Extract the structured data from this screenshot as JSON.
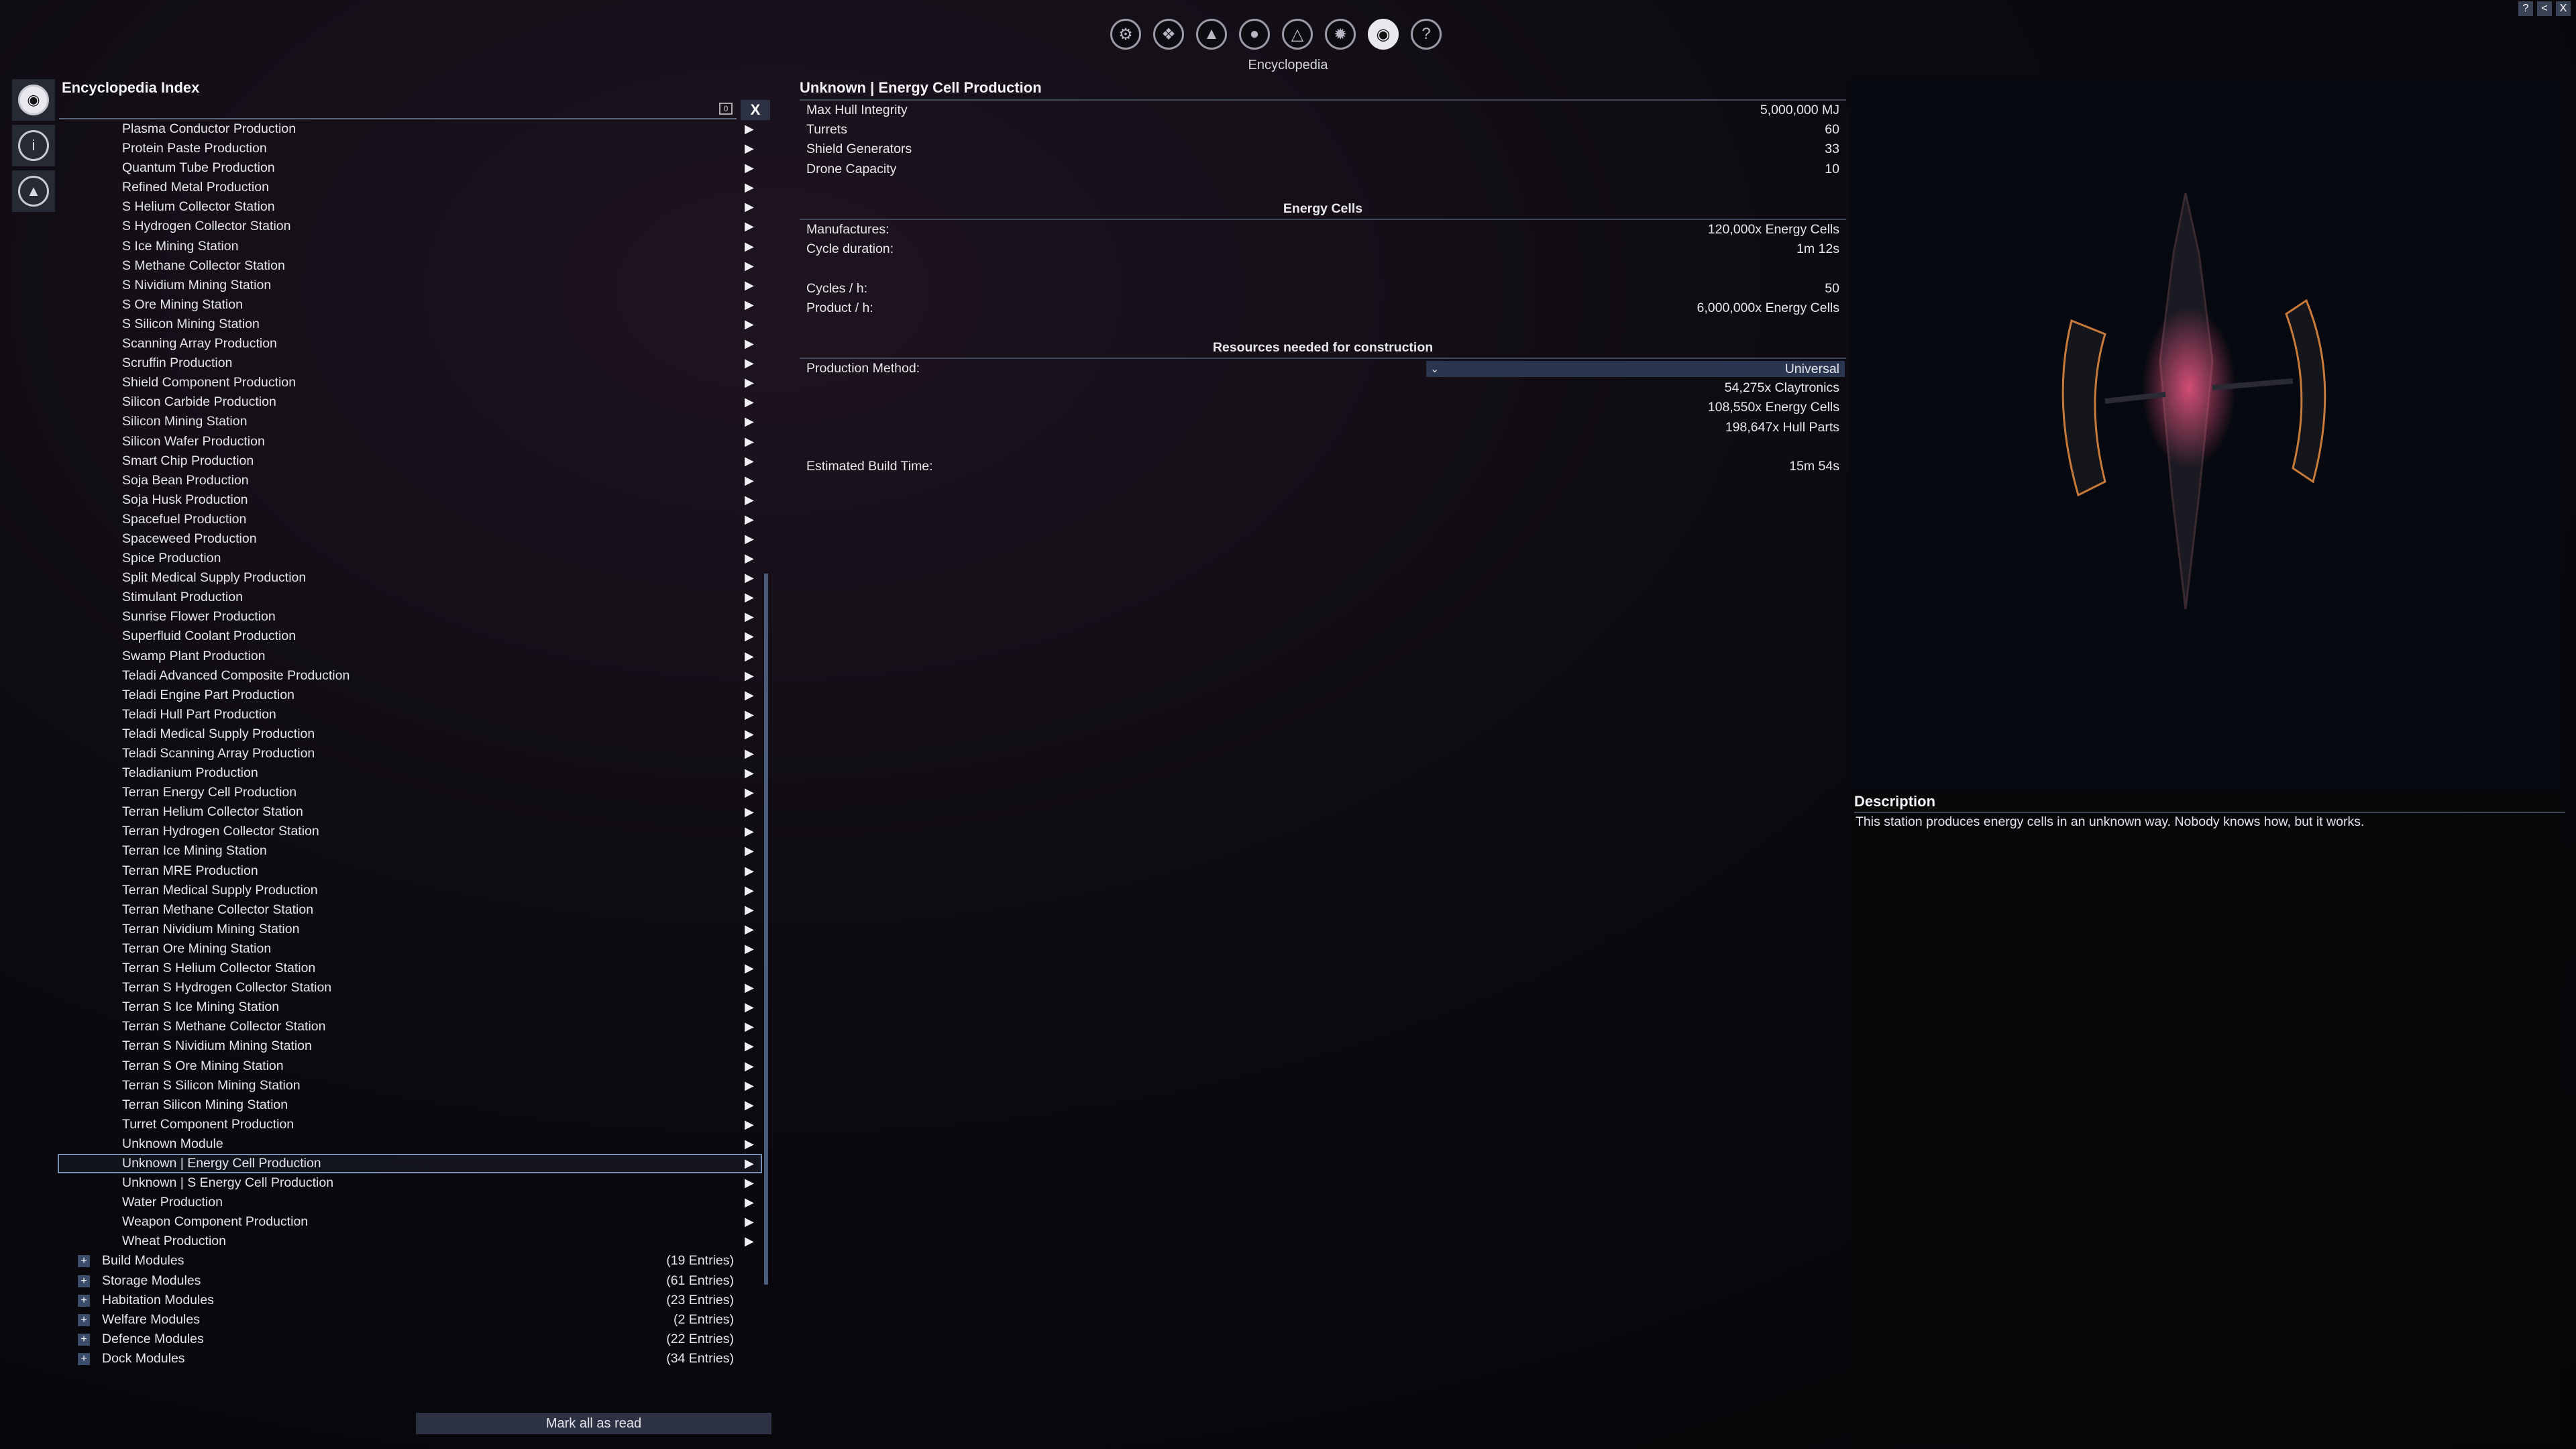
{
  "top_nav": {
    "title": "Encyclopedia",
    "icons": [
      "gear-icon",
      "satellite-icon",
      "ship-icon",
      "person-icon",
      "rocket-icon",
      "wreckage-icon",
      "station-icon",
      "help-icon"
    ]
  },
  "window_buttons": [
    "?",
    "<",
    "X"
  ],
  "index": {
    "title": "Encyclopedia Index",
    "search_clear": "0",
    "search_x": "X",
    "items": [
      "Plasma Conductor Production",
      "Protein Paste Production",
      "Quantum Tube Production",
      "Refined Metal Production",
      "S Helium Collector Station",
      "S Hydrogen Collector Station",
      "S Ice Mining Station",
      "S Methane Collector Station",
      "S Nividium Mining Station",
      "S Ore Mining Station",
      "S Silicon Mining Station",
      "Scanning Array Production",
      "Scruffin Production",
      "Shield Component Production",
      "Silicon Carbide Production",
      "Silicon Mining Station",
      "Silicon Wafer Production",
      "Smart Chip Production",
      "Soja Bean Production",
      "Soja Husk Production",
      "Spacefuel Production",
      "Spaceweed Production",
      "Spice Production",
      "Split Medical Supply Production",
      "Stimulant Production",
      "Sunrise Flower Production",
      "Superfluid Coolant Production",
      "Swamp Plant Production",
      "Teladi Advanced Composite Production",
      "Teladi Engine Part Production",
      "Teladi Hull Part Production",
      "Teladi Medical Supply Production",
      "Teladi Scanning Array Production",
      "Teladianium Production",
      "Terran Energy Cell Production",
      "Terran Helium Collector Station",
      "Terran Hydrogen Collector Station",
      "Terran Ice Mining Station",
      "Terran MRE Production",
      "Terran Medical Supply Production",
      "Terran Methane Collector Station",
      "Terran Nividium Mining Station",
      "Terran Ore Mining Station",
      "Terran S Helium Collector Station",
      "Terran S Hydrogen Collector Station",
      "Terran S Ice Mining Station",
      "Terran S Methane Collector Station",
      "Terran S Nividium Mining Station",
      "Terran S Ore Mining Station",
      "Terran S Silicon Mining Station",
      "Terran Silicon Mining Station",
      "Turret Component Production",
      "Unknown Module",
      "Unknown | Energy Cell Production",
      "Unknown | S Energy Cell Production",
      "Water Production",
      "Weapon Component Production",
      "Wheat Production"
    ],
    "selected_index": 53,
    "groups": [
      {
        "label": "Build Modules",
        "count": "(19 Entries)"
      },
      {
        "label": "Storage Modules",
        "count": "(61 Entries)"
      },
      {
        "label": "Habitation Modules",
        "count": "(23 Entries)"
      },
      {
        "label": "Welfare Modules",
        "count": "(2 Entries)"
      },
      {
        "label": "Defence Modules",
        "count": "(22 Entries)"
      },
      {
        "label": "Dock Modules",
        "count": "(34 Entries)"
      }
    ],
    "mark_all_read": "Mark all as read"
  },
  "details": {
    "title": "Unknown | Energy Cell Production",
    "stats": [
      {
        "k": "Max Hull Integrity",
        "v": "5,000,000 MJ"
      },
      {
        "k": "Turrets",
        "v": "60"
      },
      {
        "k": "Shield Generators",
        "v": "33"
      },
      {
        "k": "Drone Capacity",
        "v": "10"
      }
    ],
    "production_header": "Energy Cells",
    "manufactures_label": "Manufactures:",
    "manufactures_value": "120,000x Energy Cells",
    "cycle_label": "Cycle duration:",
    "cycle_value": "1m 12s",
    "cycles_label": "Cycles / h:",
    "cycles_value": "50",
    "product_label": "Product / h:",
    "product_value": "6,000,000x Energy Cells",
    "resources_header": "Resources needed for construction",
    "method_label": "Production Method:",
    "method_value": "Universal",
    "resources": [
      "54,275x Claytronics",
      "108,550x Energy Cells",
      "198,647x Hull Parts"
    ],
    "build_time_label": "Estimated Build Time:",
    "build_time_value": "15m 54s"
  },
  "description": {
    "title": "Description",
    "text": "This station produces energy cells in an unknown way. Nobody knows how, but it works."
  }
}
